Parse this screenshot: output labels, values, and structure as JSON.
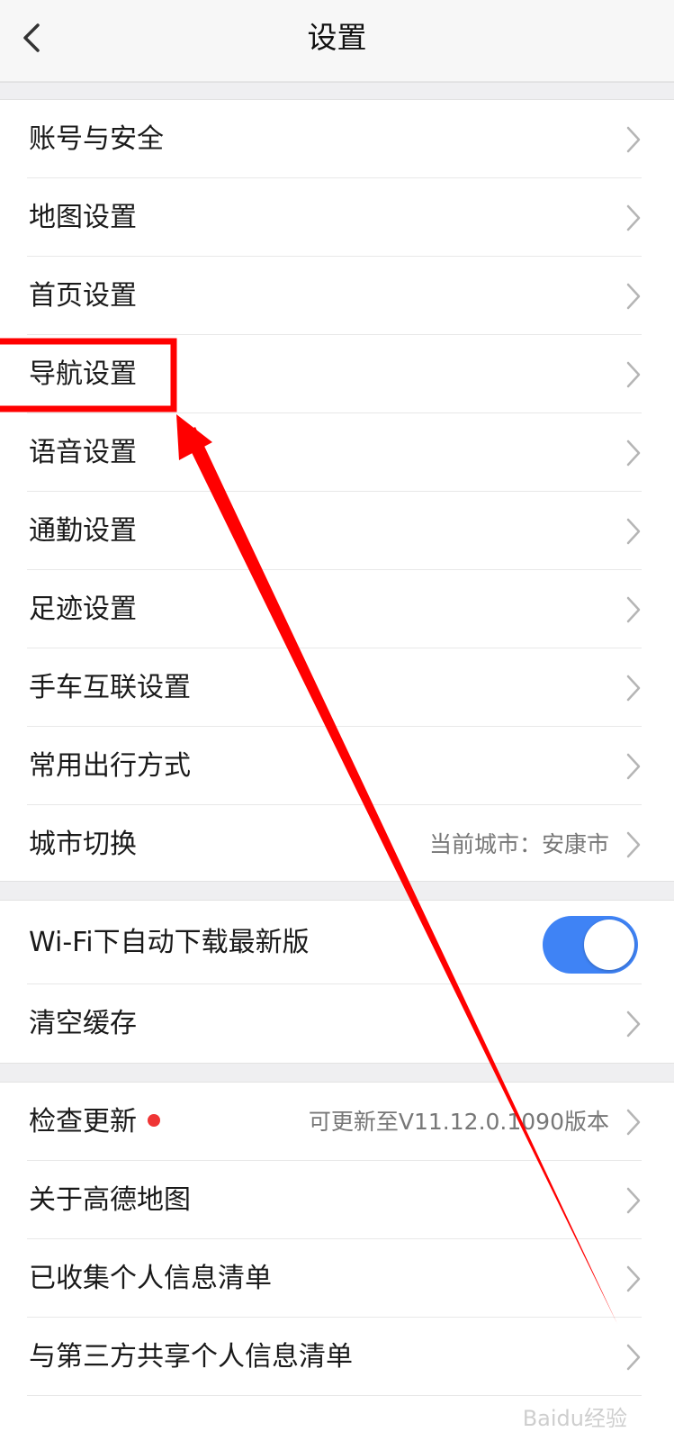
{
  "header": {
    "title": "设置"
  },
  "section1": {
    "items": [
      {
        "label": "账号与安全"
      },
      {
        "label": "地图设置"
      },
      {
        "label": "首页设置"
      },
      {
        "label": "导航设置"
      },
      {
        "label": "语音设置"
      },
      {
        "label": "通勤设置"
      },
      {
        "label": "足迹设置"
      },
      {
        "label": "手车互联设置"
      },
      {
        "label": "常用出行方式"
      },
      {
        "label": "城市切换",
        "value": "当前城市：安康市"
      }
    ]
  },
  "section2": {
    "wifi_label": "Wi-Fi下自动下载最新版",
    "wifi_toggle_on": true,
    "clear_cache_label": "清空缓存"
  },
  "section3": {
    "items": [
      {
        "label": "检查更新",
        "value": "可更新至V11.12.0.1090版本"
      },
      {
        "label": "关于高德地图"
      },
      {
        "label": "已收集个人信息清单"
      },
      {
        "label": "与第三方共享个人信息清单"
      }
    ]
  },
  "colors": {
    "toggle_on": "#3f83f5",
    "update_dot": "#ef3535",
    "annotation": "#ff0000"
  },
  "watermark": {
    "text": "Baidu经验"
  }
}
